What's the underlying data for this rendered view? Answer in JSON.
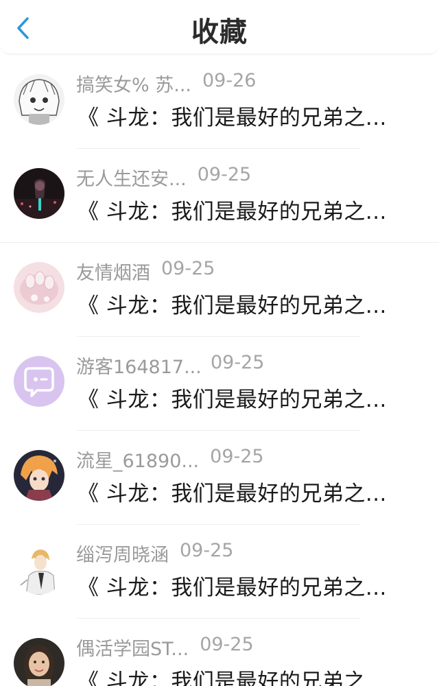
{
  "header": {
    "title": "收藏",
    "back_icon": "chevron-left-icon",
    "accent_color": "#2f95e0"
  },
  "favorites": [
    {
      "name": "搞笑女% 苏...",
      "date": "09-26",
      "title": "《 斗龙：我们是最好的兄弟之...",
      "avatar": "manga-girl-avatar"
    },
    {
      "name": "无人生还安...",
      "date": "09-25",
      "title": "《 斗龙：我们是最好的兄弟之...",
      "avatar": "night-scene-avatar"
    },
    {
      "name": "友情烟酒",
      "date": "09-25",
      "title": "《 斗龙：我们是最好的兄弟之...",
      "avatar": "pink-nails-avatar"
    },
    {
      "name": "游客164817...",
      "date": "09-25",
      "title": "《 斗龙：我们是最好的兄弟之...",
      "avatar": "default-chat-avatar"
    },
    {
      "name": "流星_61890...",
      "date": "09-25",
      "title": "《 斗龙：我们是最好的兄弟之...",
      "avatar": "anime-boy-avatar"
    },
    {
      "name": "缁泻周晓涵",
      "date": "09-25",
      "title": "《 斗龙：我们是最好的兄弟之...",
      "avatar": "anime-character-avatar"
    },
    {
      "name": "偶活学园ST...",
      "date": "09-25",
      "title": "《 斗龙：我们是最好的兄弟之...",
      "avatar": "portrait-photo-avatar"
    }
  ]
}
